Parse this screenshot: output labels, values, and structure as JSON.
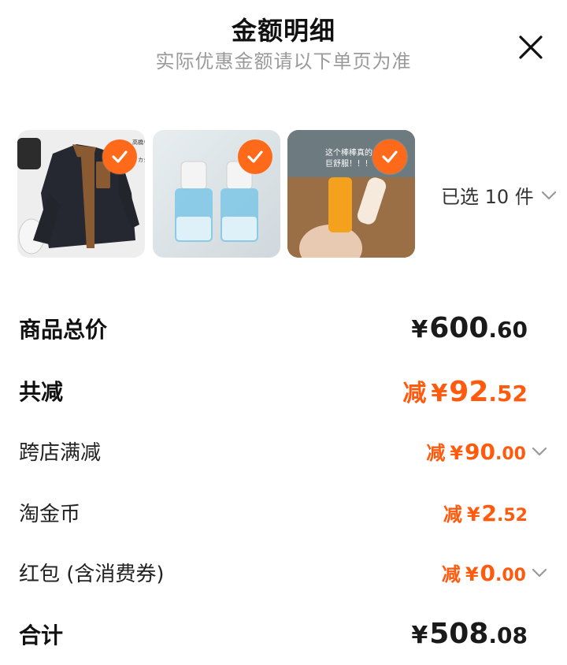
{
  "header": {
    "title": "金额明细",
    "subtitle": "实际优惠金额请以下单页为准"
  },
  "products": {
    "items": [
      {
        "name": "fleece-jacket",
        "checked": true,
        "overlay_text": [
          "高橋リカさんの",
          "ドカジュアル"
        ]
      },
      {
        "name": "lens-cleaner-bottles",
        "checked": true
      },
      {
        "name": "lip-oil",
        "checked": true,
        "overlay_text": [
          "这个棒棒真的",
          "巨舒服！！！"
        ]
      }
    ],
    "selected_label": "已选 10 件"
  },
  "rows": {
    "subtotal": {
      "label": "商品总价",
      "yen": "¥",
      "int": "600",
      "dec": ".60"
    },
    "total_discount": {
      "label": "共减",
      "prefix": "减",
      "yen": "¥",
      "int": "92",
      "dec": ".52"
    },
    "cross_store": {
      "label": "跨店满减",
      "prefix": "减",
      "yen": "¥",
      "int": "90",
      "dec": ".00"
    },
    "taojinbi": {
      "label": "淘金币",
      "prefix": "减",
      "yen": "¥",
      "int": "2",
      "dec": ".52"
    },
    "red_packet": {
      "label": "红包 (含消费券)",
      "prefix": "减",
      "yen": "¥",
      "int": "0",
      "dec": ".00"
    },
    "total": {
      "label": "合计",
      "yen": "¥",
      "int": "508",
      "dec": ".08"
    }
  },
  "colors": {
    "accent": "#ff5a0d",
    "text": "#111111",
    "muted": "#9a9a9a"
  },
  "icons": {
    "close": "close-icon",
    "check": "check-icon",
    "chevron": "chevron-down-icon"
  }
}
